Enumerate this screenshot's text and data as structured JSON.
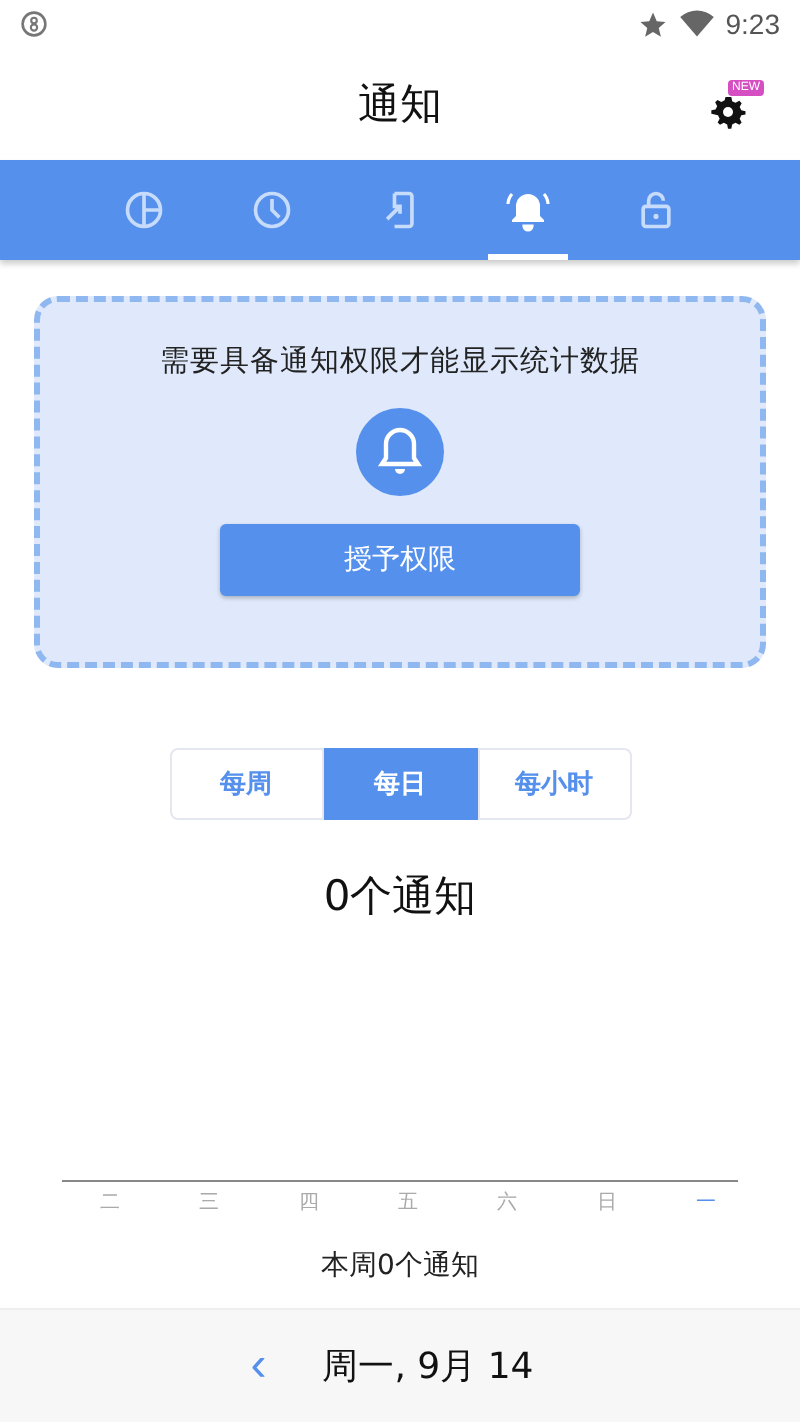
{
  "status_bar": {
    "time": "9:23"
  },
  "title_bar": {
    "title": "通知",
    "badge": "NEW"
  },
  "tabs": [
    {
      "kind": "pie",
      "selected": false
    },
    {
      "kind": "clock",
      "selected": false
    },
    {
      "kind": "phone",
      "selected": false
    },
    {
      "kind": "bell",
      "selected": true
    },
    {
      "kind": "lock",
      "selected": false
    }
  ],
  "permission_card": {
    "message": "需要具备通知权限才能显示统计数据",
    "button": "授予权限"
  },
  "periods": [
    {
      "label": "每周",
      "selected": false
    },
    {
      "label": "每日",
      "selected": true
    },
    {
      "label": "每小时",
      "selected": false
    }
  ],
  "total": "0个通知",
  "days": [
    {
      "label": "二",
      "selected": false
    },
    {
      "label": "三",
      "selected": false
    },
    {
      "label": "四",
      "selected": false
    },
    {
      "label": "五",
      "selected": false
    },
    {
      "label": "六",
      "selected": false
    },
    {
      "label": "日",
      "selected": false
    },
    {
      "label": "一",
      "selected": true
    }
  ],
  "week_summary": "本周0个通知",
  "date_nav": {
    "prev": "‹",
    "date": "周一, 9月 14"
  }
}
